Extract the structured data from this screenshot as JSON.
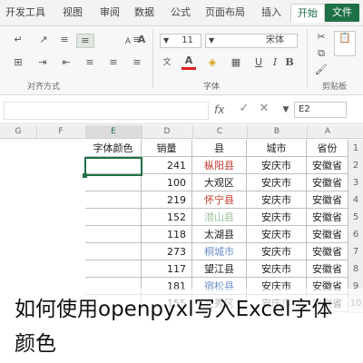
{
  "ribbon": {
    "tabs": [
      "文件",
      "开始",
      "插入",
      "页面布局",
      "公式",
      "数据",
      "审阅",
      "视图",
      "开发工具"
    ],
    "active_tab": "开始",
    "groups": {
      "clipboard": "剪贴板",
      "font": "字体",
      "alignment": "对齐方式"
    },
    "font_name": "宋体",
    "font_size": "11",
    "bold": "B",
    "italic": "I",
    "underline": "U",
    "font_color_letter": "A"
  },
  "formula_bar": {
    "name_box": "E2",
    "fx": "fx"
  },
  "columns": [
    "A",
    "B",
    "C",
    "D",
    "E",
    "F",
    "G"
  ],
  "rows": [
    "1",
    "2",
    "3",
    "4",
    "5",
    "6",
    "7",
    "8",
    "9",
    "10"
  ],
  "table": {
    "headers": [
      "省份",
      "城市",
      "县",
      "销量",
      "字体颜色"
    ],
    "data": [
      {
        "province": "安徽省",
        "city": "安庆市",
        "county": "枞阳县",
        "sales": "241",
        "county_color": "#c0392b"
      },
      {
        "province": "安徽省",
        "city": "安庆市",
        "county": "大观区",
        "sales": "100",
        "county_color": "#222222"
      },
      {
        "province": "安徽省",
        "city": "安庆市",
        "county": "怀宁县",
        "sales": "219",
        "county_color": "#c0392b"
      },
      {
        "province": "安徽省",
        "city": "安庆市",
        "county": "潜山县",
        "sales": "152",
        "county_color": "#9cc59c"
      },
      {
        "province": "安徽省",
        "city": "安庆市",
        "county": "太湖县",
        "sales": "118",
        "county_color": "#222222"
      },
      {
        "province": "安徽省",
        "city": "安庆市",
        "county": "桐城市",
        "sales": "273",
        "county_color": "#6a8fc9"
      },
      {
        "province": "安徽省",
        "city": "安庆市",
        "county": "望江县",
        "sales": "117",
        "county_color": "#222222"
      },
      {
        "province": "安徽省",
        "city": "安庆市",
        "county": "宿松县",
        "sales": "181",
        "county_color": "#6a8fc9"
      },
      {
        "province": "安徽省",
        "city": "安庆市",
        "county": "宜秀区",
        "sales": "155",
        "county_color": "#222222"
      }
    ]
  },
  "caption": {
    "line1": "如何使用openpyxl写入Excel字体",
    "line2": "颜色"
  },
  "colors": {
    "accent": "#1e7145"
  }
}
